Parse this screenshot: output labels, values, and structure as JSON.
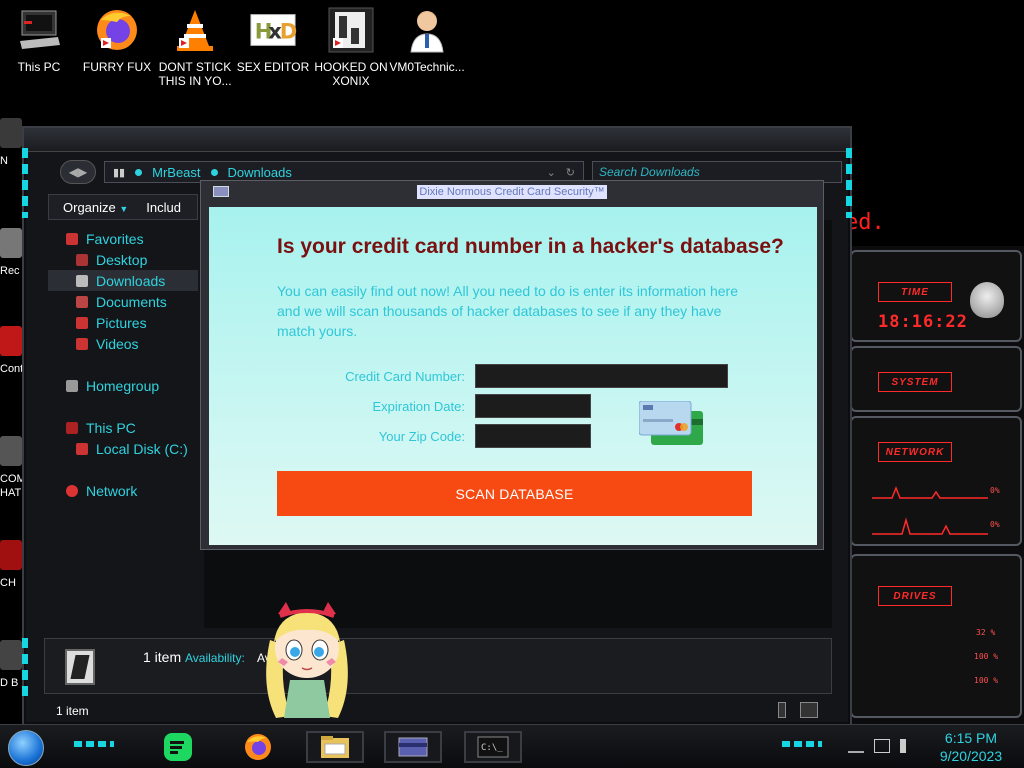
{
  "desktop": {
    "icons": [
      {
        "label": "This PC",
        "icon": "computer-icon"
      },
      {
        "label": "FURRY FUX",
        "icon": "firefox-icon"
      },
      {
        "label": "DONT STICK THIS IN YO...",
        "icon": "vlc-icon"
      },
      {
        "label": "SEX EDITOR",
        "icon": "hex-editor-icon"
      },
      {
        "label": "HOOKED ON XONIX",
        "icon": "xonix-game-icon"
      },
      {
        "label": "VM0Technic...",
        "icon": "doctor-icon"
      }
    ],
    "left_partial_labels": [
      "N",
      "Rec",
      "Cont",
      "COM HATE",
      "CH",
      "D B"
    ],
    "red_text": "ed."
  },
  "explorer": {
    "address": {
      "segments": [
        "MrBeast",
        "Downloads"
      ]
    },
    "search_placeholder": "Search Downloads",
    "toolbar": {
      "organize_label": "Organize",
      "include_label": "Includ"
    },
    "sidebar": {
      "favorites": "Favorites",
      "desktop": "Desktop",
      "downloads": "Downloads",
      "documents": "Documents",
      "pictures": "Pictures",
      "videos": "Videos",
      "homegroup": "Homegroup",
      "this_pc": "This PC",
      "local_disk": "Local Disk (C:)",
      "network": "Network"
    },
    "details": {
      "count": "1 item",
      "availability_label": "Availability:",
      "availability_value": "Availa"
    },
    "status": "1 item"
  },
  "popup": {
    "title": "Dixie Normous Credit Card Security™",
    "heading": "Is your credit card number in a hacker's database?",
    "intro": "You can easily find out now! All you need to do is enter its information here and we will scan thousands of hacker databases to see if any they have match yours.",
    "fields": {
      "card_number_label": "Credit Card Number:",
      "expiration_label": "Expiration Date:",
      "zip_label": "Your Zip Code:"
    },
    "scan_button": "SCAN DATABASE"
  },
  "gadget": {
    "time_label": "TIME",
    "clock": "18:16:22",
    "system_label": "SYSTEM",
    "network_label": "NETWORK",
    "network_stats": [
      "0%",
      "0%"
    ],
    "drives_label": "DRIVES",
    "drive_stats": [
      "32 %",
      "100 %",
      "100 %"
    ]
  },
  "taskbar": {
    "time": "6:15 PM",
    "date": "9/20/2023",
    "apps": [
      "spotify-icon",
      "firefox-icon",
      "file-explorer-icon",
      "credit-card-app-icon",
      "command-prompt-icon"
    ]
  },
  "colors": {
    "accent_cyan": "#2fd3e0",
    "scan_button": "#f74a12",
    "heading_red": "#7a1010",
    "gadget_red": "#ff2a2a"
  }
}
